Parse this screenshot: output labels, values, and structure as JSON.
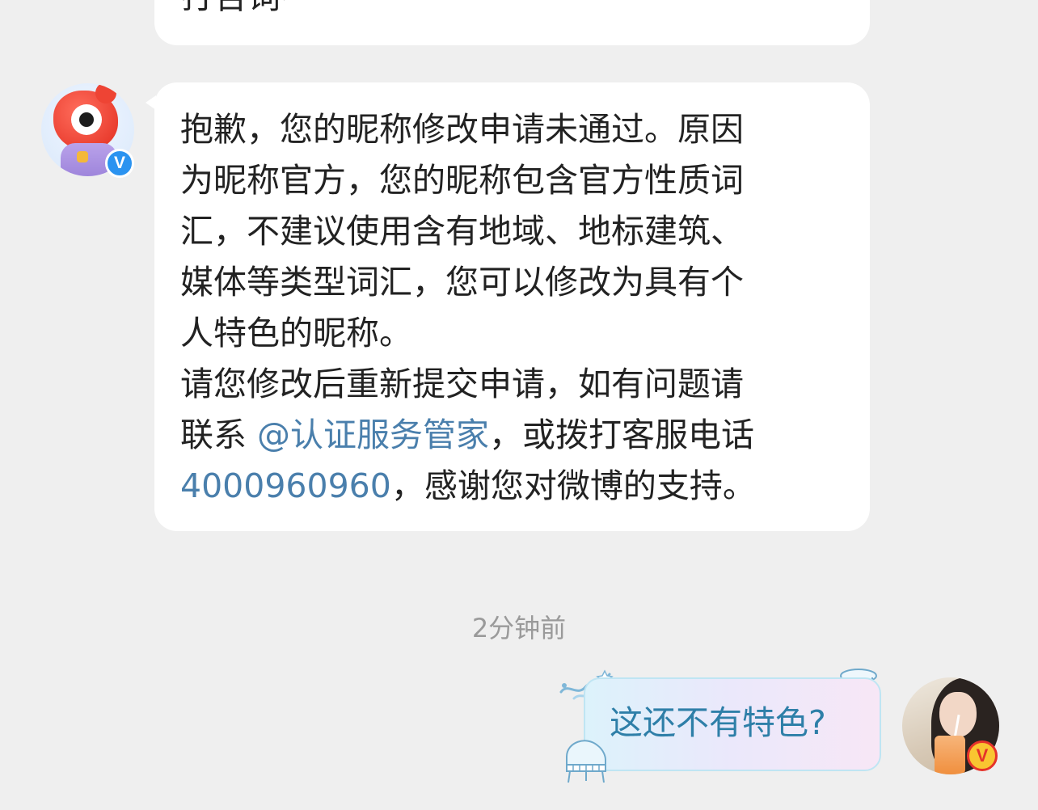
{
  "previous_message": {
    "text": "打告词~"
  },
  "service_message": {
    "lines": [
      "抱歉，您的昵称修改申请未通过。原因",
      "为昵称官方，您的昵称包含官方性质词",
      "汇，不建议使用含有地域、地标建筑、",
      "媒体等类型词汇，您可以修改为具有个",
      "人特色的昵称。",
      "请您修改后重新提交申请，如有问题请"
    ],
    "line7_prefix": "联系 ",
    "mention": "@认证服务管家",
    "line7_suffix": "，或拨打客服电话",
    "phone": "4000960960",
    "line8_suffix": "，感谢您对微博的支持。"
  },
  "timestamp": "2分钟前",
  "my_message": {
    "text": "这还不有特色?"
  },
  "icons": {
    "left_verified": "V",
    "right_verified": "V"
  },
  "colors": {
    "background": "#efefef",
    "link": "#4a7fac",
    "my_bubble_text": "#2e7fa8",
    "verified_blue": "#2b93f0",
    "verified_gold": "#f9c531"
  }
}
